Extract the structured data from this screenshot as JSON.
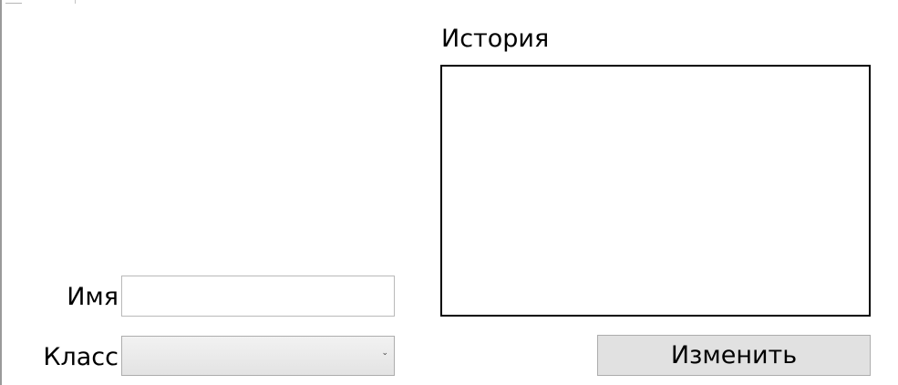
{
  "form": {
    "history_label": "История",
    "history_value": "",
    "name_label": "Имя",
    "name_value": "",
    "class_label": "Класс",
    "class_selected": "",
    "change_button_label": "Изменить"
  }
}
